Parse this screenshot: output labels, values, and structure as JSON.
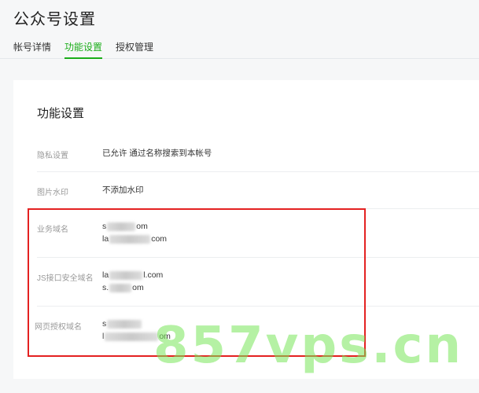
{
  "page": {
    "title": "公众号设置"
  },
  "tabs": [
    {
      "label": "帐号详情",
      "active": false
    },
    {
      "label": "功能设置",
      "active": true
    },
    {
      "label": "授权管理",
      "active": false
    }
  ],
  "section": {
    "title": "功能设置"
  },
  "rows": {
    "privacy": {
      "label": "隐私设置",
      "value": "已允许 通过名称搜索到本帐号"
    },
    "watermark": {
      "label": "图片水印",
      "value": "不添加水印"
    },
    "business_domain": {
      "label": "业务域名",
      "domains": [
        {
          "prefix": "s",
          "suffix": "om"
        },
        {
          "prefix": "la",
          "suffix": "com"
        }
      ]
    },
    "js_domain": {
      "label": "JS接口安全域名",
      "domains": [
        {
          "prefix": "la",
          "suffix": "l.com"
        },
        {
          "prefix": "s.",
          "suffix": "om"
        }
      ]
    },
    "oauth_domain": {
      "label": "网页授权域名",
      "domains": [
        {
          "prefix": "s",
          "suffix": ""
        },
        {
          "prefix": "l",
          "suffix": "om"
        }
      ]
    }
  },
  "overlay": {
    "watermark_text": "857vps.cn"
  },
  "colors": {
    "accent": "#1aad19",
    "highlight": "#e42121",
    "watermark": "#78e65a"
  }
}
